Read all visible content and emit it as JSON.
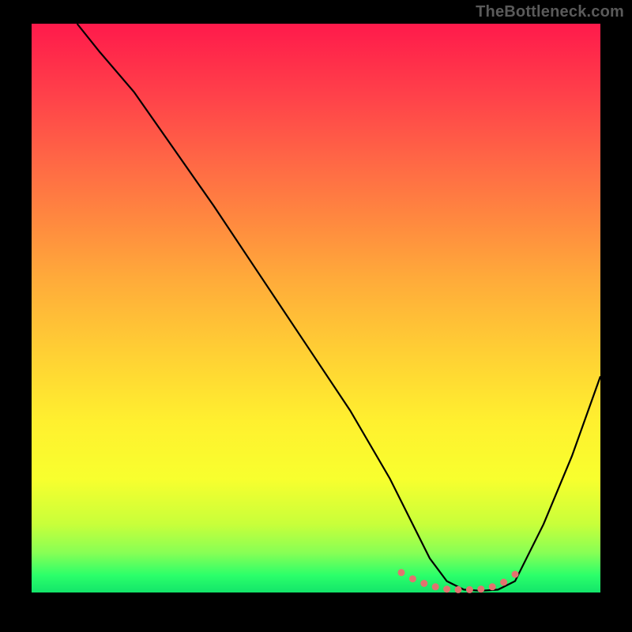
{
  "watermark": "TheBottleneck.com",
  "chart_data": {
    "type": "line",
    "title": "",
    "xlabel": "",
    "ylabel": "",
    "xlim": [
      0,
      100
    ],
    "ylim": [
      0,
      100
    ],
    "series": [
      {
        "name": "bottleneck-curve",
        "x": [
          8,
          12,
          18,
          25,
          32,
          40,
          48,
          56,
          63,
          67,
          70,
          73,
          76,
          79,
          82,
          85,
          90,
          95,
          100
        ],
        "y": [
          100,
          95,
          88,
          78,
          68,
          56,
          44,
          32,
          20,
          12,
          6,
          2,
          0.5,
          0.3,
          0.5,
          2,
          12,
          24,
          38
        ]
      }
    ],
    "marker_points": {
      "name": "highlight-dots",
      "x": [
        65,
        67,
        69,
        71,
        73,
        75,
        77,
        79,
        81,
        83,
        85
      ],
      "y": [
        3.5,
        2.4,
        1.6,
        1.0,
        0.6,
        0.5,
        0.5,
        0.6,
        1.0,
        1.8,
        3.2
      ]
    },
    "background": "rainbow-vertical-gradient",
    "frame_color": "#000000"
  }
}
